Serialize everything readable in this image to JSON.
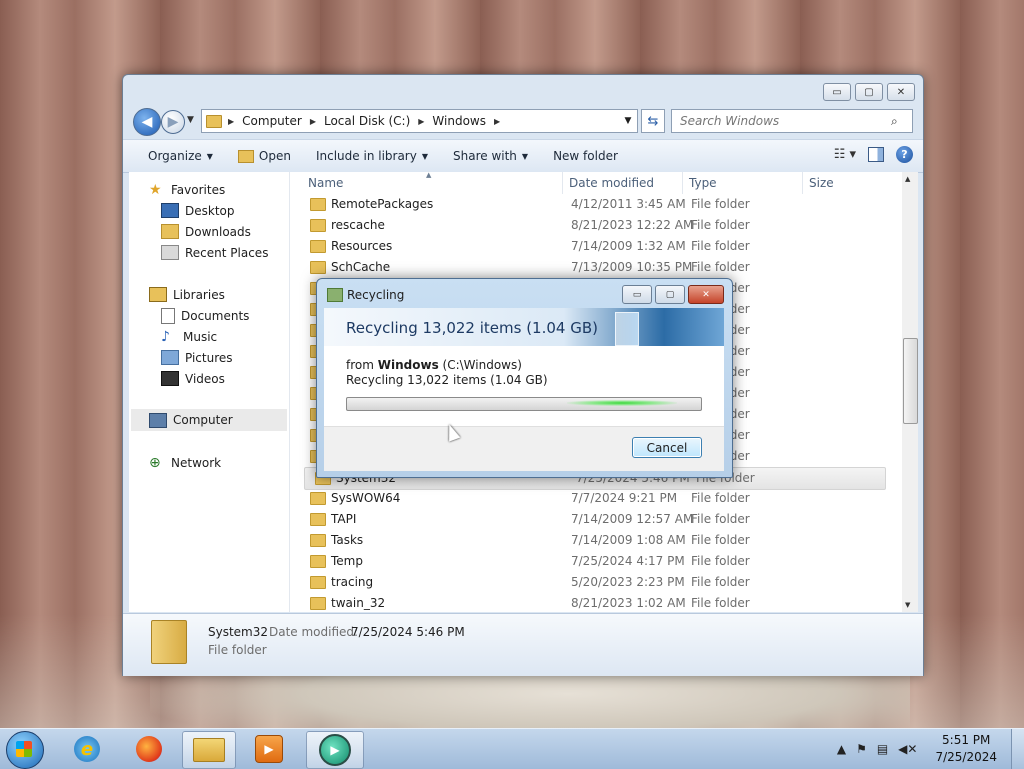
{
  "explorer": {
    "caption": {
      "minimize": "▭",
      "maximize": "▢",
      "close": "✕"
    },
    "address": {
      "crumbs": [
        "Computer",
        "Local Disk (C:)",
        "Windows"
      ]
    },
    "search": {
      "placeholder": "Search Windows"
    },
    "toolbar": {
      "organize": "Organize",
      "open": "Open",
      "include_in_library": "Include in library",
      "share_with": "Share with",
      "new_folder": "New folder"
    },
    "nav": {
      "favorites": "Favorites",
      "desktop": "Desktop",
      "downloads": "Downloads",
      "recent_places": "Recent Places",
      "libraries": "Libraries",
      "documents": "Documents",
      "music": "Music",
      "pictures": "Pictures",
      "videos": "Videos",
      "computer": "Computer",
      "network": "Network"
    },
    "columns": {
      "name": "Name",
      "date_modified": "Date modified",
      "type": "Type",
      "size": "Size"
    },
    "files": [
      {
        "name": "RemotePackages",
        "date": "4/12/2011 3:45 AM",
        "type": "File folder"
      },
      {
        "name": "rescache",
        "date": "8/21/2023 12:22 AM",
        "type": "File folder"
      },
      {
        "name": "Resources",
        "date": "7/14/2009 1:32 AM",
        "type": "File folder"
      },
      {
        "name": "SchCache",
        "date": "7/13/2009 10:35 PM",
        "type": "File folder"
      },
      {
        "name": "",
        "date": "",
        "type": "File folder"
      },
      {
        "name": "",
        "date": "",
        "type": "File folder"
      },
      {
        "name": "",
        "date": "",
        "type": "File folder"
      },
      {
        "name": "",
        "date": "",
        "type": "File folder"
      },
      {
        "name": "",
        "date": "",
        "type": "File folder"
      },
      {
        "name": "",
        "date": "",
        "type": "File folder"
      },
      {
        "name": "",
        "date": "",
        "type": "File folder"
      },
      {
        "name": "",
        "date": "",
        "type": "File folder"
      },
      {
        "name": "",
        "date": "",
        "type": "File folder"
      },
      {
        "name": "System32",
        "date": "7/25/2024 5:46 PM",
        "type": "File folder",
        "selected": true
      },
      {
        "name": "SysWOW64",
        "date": "7/7/2024 9:21 PM",
        "type": "File folder"
      },
      {
        "name": "TAPI",
        "date": "7/14/2009 12:57 AM",
        "type": "File folder"
      },
      {
        "name": "Tasks",
        "date": "7/14/2009 1:08 AM",
        "type": "File folder"
      },
      {
        "name": "Temp",
        "date": "7/25/2024 4:17 PM",
        "type": "File folder"
      },
      {
        "name": "tracing",
        "date": "5/20/2023 2:23 PM",
        "type": "File folder"
      },
      {
        "name": "twain_32",
        "date": "8/21/2023 1:02 AM",
        "type": "File folder"
      }
    ],
    "details": {
      "name": "System32",
      "modified_label": "Date modified:",
      "modified_value": "7/25/2024 5:46 PM",
      "type": "File folder"
    }
  },
  "dialog": {
    "title": "Recycling",
    "header": "Recycling 13,022 items (1.04 GB)",
    "from_prefix": "from ",
    "from_name": "Windows",
    "from_path": " (C:\\Windows)",
    "count_line": "Recycling 13,022 items (1.04 GB)",
    "cancel": "Cancel",
    "buttons": {
      "minimize": "▭",
      "maximize": "▢",
      "close": "✕"
    }
  },
  "taskbar": {
    "time": "5:51 PM",
    "date": "7/25/2024",
    "apps": [
      "Internet Explorer",
      "Firefox",
      "Windows Explorer",
      "Windows Media Player",
      "Recycle"
    ]
  }
}
